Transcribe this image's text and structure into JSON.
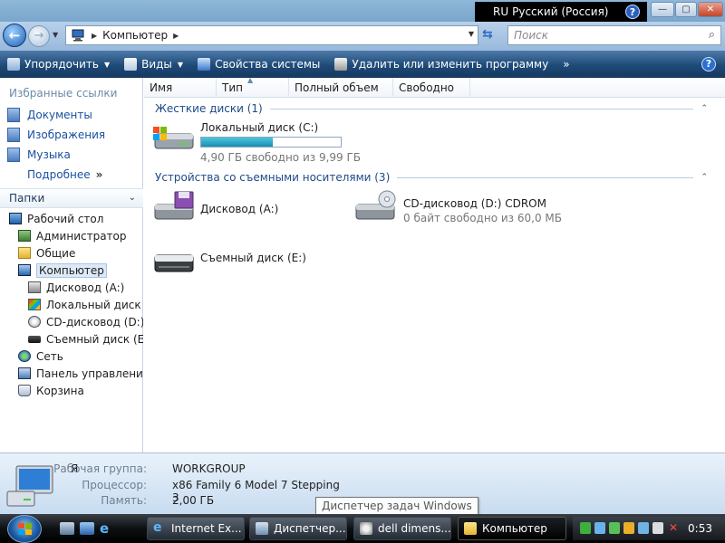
{
  "titlebar": {
    "lang_code": "RU",
    "lang_name": "Русский (Россия)",
    "help_icon": "help-icon",
    "minimize_label": "—",
    "maximize_label": "▢",
    "close_label": "✕"
  },
  "address": {
    "computer_icon": "computer-icon",
    "breadcrumb": "Компьютер",
    "search_placeholder": "Поиск"
  },
  "commandbar": {
    "organize": "Упорядочить",
    "views": "Виды",
    "system_properties": "Свойства системы",
    "uninstall": "Удалить или изменить программу",
    "more": "»"
  },
  "leftnav": {
    "favorites_title": "Избранные ссылки",
    "favorites": [
      {
        "label": "Документы",
        "icon": "documents-icon"
      },
      {
        "label": "Изображения",
        "icon": "pictures-icon"
      },
      {
        "label": "Музыка",
        "icon": "music-icon"
      }
    ],
    "more_label": "Подробнее",
    "more_arrow": "»",
    "folders_title": "Папки",
    "tree": [
      {
        "label": "Рабочий стол",
        "icon": "desktop-icon",
        "level": 0
      },
      {
        "label": "Администратор",
        "icon": "user-folder-icon",
        "level": 1
      },
      {
        "label": "Общие",
        "icon": "folder-icon",
        "level": 1
      },
      {
        "label": "Компьютер",
        "icon": "computer-icon",
        "level": 1,
        "selected": true
      },
      {
        "label": "Дисковод (A:)",
        "icon": "floppy-drive-icon",
        "level": 2
      },
      {
        "label": "Локальный диск (C",
        "icon": "local-disk-icon",
        "level": 2
      },
      {
        "label": "CD-дисковод (D:) C",
        "icon": "cd-drive-icon",
        "level": 2
      },
      {
        "label": "Съемный диск (E:)",
        "icon": "removable-disk-icon",
        "level": 2
      },
      {
        "label": "Сеть",
        "icon": "network-icon",
        "level": 1
      },
      {
        "label": "Панель управления",
        "icon": "control-panel-icon",
        "level": 1
      },
      {
        "label": "Корзина",
        "icon": "recycle-bin-icon",
        "level": 1
      }
    ]
  },
  "content": {
    "columns": [
      "Имя",
      "Тип",
      "Полный объем",
      "Свободно"
    ],
    "group_hdd": "Жесткие диски (1)",
    "group_removable": "Устройства со съемными носителями (3)",
    "local_disk": {
      "name": "Локальный диск (C:)",
      "free_text": "4,90 ГБ свободно из 9,99 ГБ",
      "used_fraction": 0.51
    },
    "floppy": {
      "name": "Дисковод (A:)"
    },
    "cdrom": {
      "name": "CD-дисковод (D:) CDROM",
      "free_text": "0 байт свободно из 60,0 МБ"
    },
    "removable": {
      "name": "Съемный диск (E:)"
    }
  },
  "details": {
    "user_prefix": "Я",
    "workgroup_label": "Рабочая группа:",
    "workgroup_value": "WORKGROUP",
    "cpu_label": "Процессор:",
    "cpu_value": "x86 Family 6 Model 7 Stepping 3",
    "memory_label": "Память:",
    "memory_value": "2,00 ГБ"
  },
  "tooltip": "Диспетчер задач Windows",
  "taskbar": {
    "buttons": [
      {
        "label": "Internet Ex...",
        "icon": "ie-icon"
      },
      {
        "label": "Диспетчер...",
        "icon": "task-manager-icon"
      },
      {
        "label": "dell dimens...",
        "icon": "dell-icon"
      },
      {
        "label": "Компьютер",
        "icon": "explorer-icon",
        "active": true
      }
    ],
    "clock": "0:53"
  }
}
